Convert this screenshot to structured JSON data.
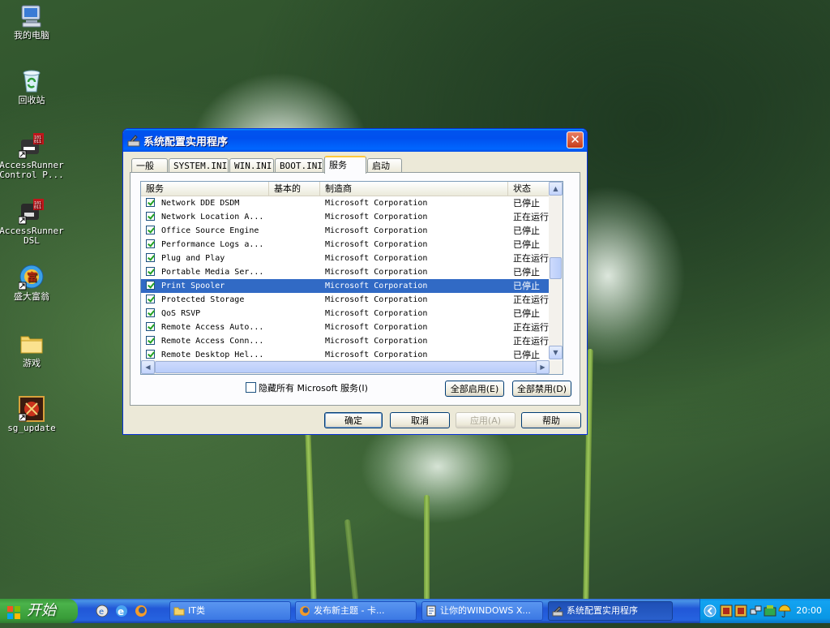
{
  "desktop": {
    "icons": [
      {
        "label": "我的电脑",
        "icon": "my-computer-icon"
      },
      {
        "label": "回收站",
        "icon": "recycle-bin-icon"
      },
      {
        "label": "AccessRunner Control P...",
        "icon": "accessrunner-control-icon"
      },
      {
        "label": "AccessRunner DSL",
        "icon": "accessrunner-dsl-icon"
      },
      {
        "label": "盛大富翁",
        "icon": "shanda-fuweng-icon"
      },
      {
        "label": "游戏",
        "icon": "folder-icon"
      },
      {
        "label": "sg_update",
        "icon": "sg-update-icon"
      }
    ]
  },
  "window": {
    "title": "系统配置实用程序",
    "tabs": [
      {
        "label": "一般"
      },
      {
        "label": "SYSTEM.INI"
      },
      {
        "label": "WIN.INI"
      },
      {
        "label": "BOOT.INI"
      },
      {
        "label": "服务",
        "active": true
      },
      {
        "label": "启动"
      }
    ],
    "columns": {
      "service": "服务",
      "essential": "基本的",
      "manufacturer": "制造商",
      "status": "状态"
    },
    "rows": [
      {
        "service": "Network DDE DSDM",
        "manufacturer": "Microsoft Corporation",
        "status": "已停止"
      },
      {
        "service": "Network Location A...",
        "manufacturer": "Microsoft Corporation",
        "status": "正在运行"
      },
      {
        "service": "Office Source Engine",
        "manufacturer": "Microsoft Corporation",
        "status": "已停止"
      },
      {
        "service": "Performance Logs a...",
        "manufacturer": "Microsoft Corporation",
        "status": "已停止"
      },
      {
        "service": "Plug and Play",
        "manufacturer": "Microsoft Corporation",
        "status": "正在运行"
      },
      {
        "service": "Portable Media Ser...",
        "manufacturer": "Microsoft Corporation",
        "status": "已停止"
      },
      {
        "service": "Print Spooler",
        "manufacturer": "Microsoft Corporation",
        "status": "已停止",
        "selected": true
      },
      {
        "service": "Protected Storage",
        "manufacturer": "Microsoft Corporation",
        "status": "正在运行"
      },
      {
        "service": "QoS RSVP",
        "manufacturer": "Microsoft Corporation",
        "status": "已停止"
      },
      {
        "service": "Remote Access Auto...",
        "manufacturer": "Microsoft Corporation",
        "status": "正在运行"
      },
      {
        "service": "Remote Access Conn...",
        "manufacturer": "Microsoft Corporation",
        "status": "正在运行"
      },
      {
        "service": "Remote Desktop Hel...",
        "manufacturer": "Microsoft Corporation",
        "status": "已停止"
      }
    ],
    "hide_ms_label": "隐藏所有 Microsoft 服务(I)",
    "enable_all": "全部启用(E)",
    "disable_all": "全部禁用(D)",
    "ok": "确定",
    "cancel": "取消",
    "apply": "应用(A)",
    "help": "帮助"
  },
  "taskbar": {
    "start_label": "开始",
    "buttons": [
      {
        "label": "IT类",
        "icon": "folder-icon"
      },
      {
        "label": "发布新主题 - 卡...",
        "icon": "firefox-icon"
      },
      {
        "label": "让你的WINDOWS X...",
        "icon": "document-icon"
      },
      {
        "label": "系统配置实用程序",
        "icon": "msconfig-icon",
        "active": true
      }
    ],
    "clock": "20:00"
  }
}
